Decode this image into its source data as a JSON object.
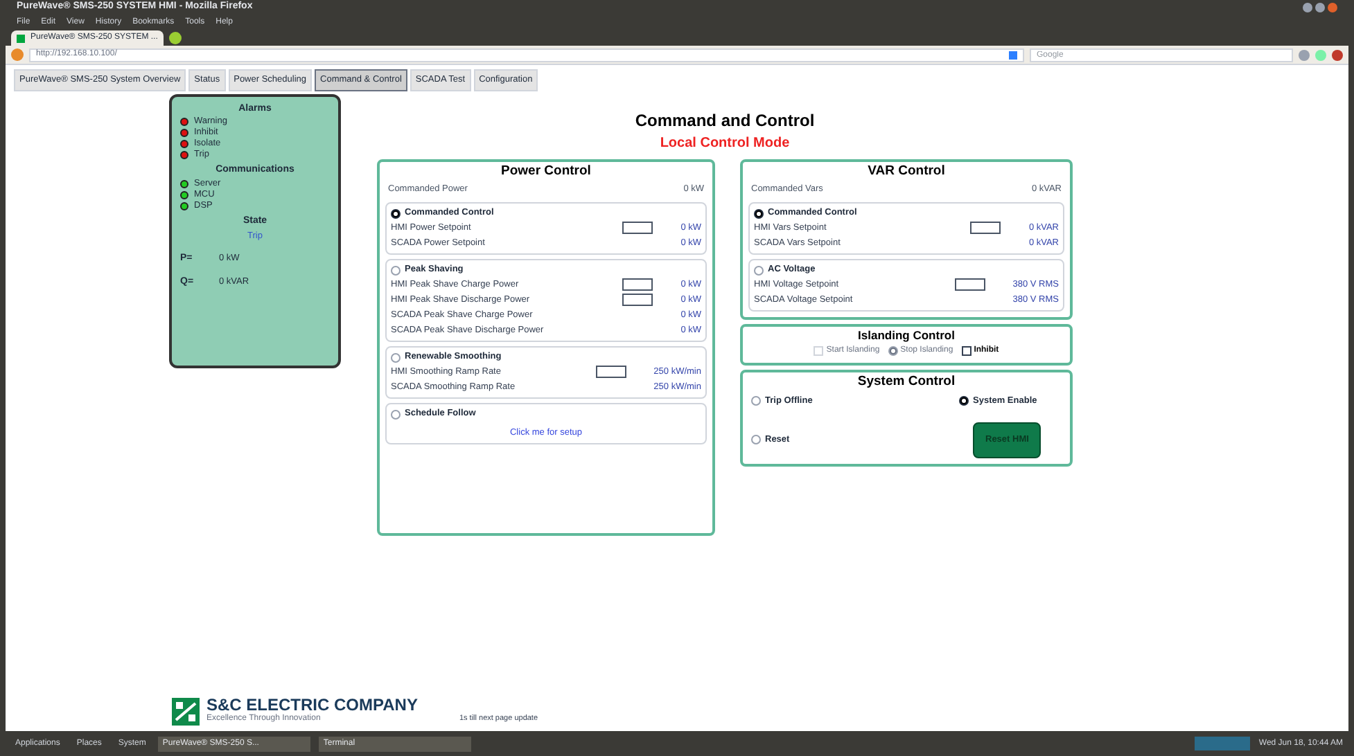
{
  "browser": {
    "title": "PureWave® SMS-250 SYSTEM HMI - Mozilla Firefox",
    "menu": [
      "File",
      "Edit",
      "View",
      "History",
      "Bookmarks",
      "Tools",
      "Help"
    ],
    "tab": "PureWave® SMS-250 SYSTEM ...",
    "url": "http://192.168.10.100/",
    "search_placeholder": "Google"
  },
  "nav_tabs": [
    {
      "label": "PureWave® SMS-250 System Overview",
      "selected": false
    },
    {
      "label": "Status",
      "selected": false
    },
    {
      "label": "Power Scheduling",
      "selected": false
    },
    {
      "label": "Command & Control",
      "selected": true
    },
    {
      "label": "SCADA Test",
      "selected": false
    },
    {
      "label": "Configuration",
      "selected": false
    }
  ],
  "status_panel": {
    "alarms_title": "Alarms",
    "alarms": [
      {
        "label": "Warning",
        "color": "#dd1111"
      },
      {
        "label": "Inhibit",
        "color": "#dd1111"
      },
      {
        "label": "Isolate",
        "color": "#dd1111"
      },
      {
        "label": "Trip",
        "color": "#dd1111"
      }
    ],
    "comms_title": "Communications",
    "comms": [
      {
        "label": "Server",
        "color": "#22cc22"
      },
      {
        "label": "MCU",
        "color": "#22cc22"
      },
      {
        "label": "DSP",
        "color": "#22cc22"
      }
    ],
    "state_title": "State",
    "state": "Trip",
    "readings": [
      {
        "label": "P=",
        "value": "0 kW"
      },
      {
        "label": "Q=",
        "value": "0 kVAR"
      }
    ]
  },
  "page": {
    "title": "Command and Control",
    "mode": "Local Control Mode"
  },
  "power_control": {
    "title": "Power Control",
    "commanded": {
      "label": "Commanded Power",
      "value": "0 kW"
    },
    "groups": [
      {
        "label": "Commanded Control",
        "selected": true,
        "rows": [
          {
            "label": "HMI Power Setpoint",
            "kind": "input",
            "value": "0 kW"
          },
          {
            "label": "SCADA Power Setpoint",
            "kind": "readout",
            "value": "0 kW"
          }
        ]
      },
      {
        "label": "Peak Shaving",
        "selected": false,
        "rows": [
          {
            "label": "HMI Peak Shave Charge Power",
            "kind": "input",
            "value": "0 kW"
          },
          {
            "label": "HMI Peak Shave Discharge Power",
            "kind": "input",
            "value": "0 kW"
          },
          {
            "label": "SCADA Peak Shave Charge Power",
            "kind": "readout",
            "value": "0 kW"
          },
          {
            "label": "SCADA Peak Shave Discharge Power",
            "kind": "readout",
            "value": "0 kW"
          }
        ]
      },
      {
        "label": "Renewable Smoothing",
        "selected": false,
        "rows": [
          {
            "label": "HMI Smoothing Ramp Rate",
            "kind": "input",
            "value": "250 kW/min"
          },
          {
            "label": "SCADA Smoothing Ramp Rate",
            "kind": "readout",
            "value": "250 kW/min"
          }
        ]
      },
      {
        "label": "Schedule Follow",
        "selected": false,
        "link": "Click me for setup"
      }
    ]
  },
  "var_control": {
    "title": "VAR Control",
    "commanded": {
      "label": "Commanded Vars",
      "value": "0 kVAR"
    },
    "groups": [
      {
        "label": "Commanded Control",
        "selected": true,
        "rows": [
          {
            "label": "HMI Vars Setpoint",
            "kind": "input",
            "value": "0 kVAR"
          },
          {
            "label": "SCADA Vars Setpoint",
            "kind": "readout",
            "value": "0 kVAR"
          }
        ]
      },
      {
        "label": "AC Voltage",
        "selected": false,
        "rows": [
          {
            "label": "HMI Voltage Setpoint",
            "kind": "input",
            "value": "380 V RMS"
          },
          {
            "label": "SCADA Voltage Setpoint",
            "kind": "readout",
            "value": "380 V RMS"
          }
        ]
      }
    ]
  },
  "islanding_control": {
    "title": "Islanding Control",
    "options": [
      {
        "label": "Start Islanding",
        "kind": "checkbox",
        "checked": false,
        "disabled": true
      },
      {
        "label": "Stop Islanding",
        "kind": "radio",
        "checked": true,
        "disabled": true
      },
      {
        "label": "Inhibit",
        "kind": "checkbox",
        "checked": false,
        "disabled": false
      }
    ]
  },
  "system_control": {
    "title": "System Control",
    "options": [
      {
        "label": "Trip Offline",
        "selected": false
      },
      {
        "label": "System Enable",
        "selected": true
      },
      {
        "label": "Reset",
        "selected": false
      }
    ],
    "button": "Reset HMI"
  },
  "footer": {
    "company": "S&C ELECTRIC COMPANY",
    "tagline": "Excellence Through Innovation",
    "update": "1s till next page update"
  },
  "taskbar": {
    "items": [
      "Applications",
      "Places",
      "System",
      "PureWave® SMS-250 S...",
      "Terminal"
    ],
    "clock": "Wed Jun 18, 10:44 AM"
  }
}
